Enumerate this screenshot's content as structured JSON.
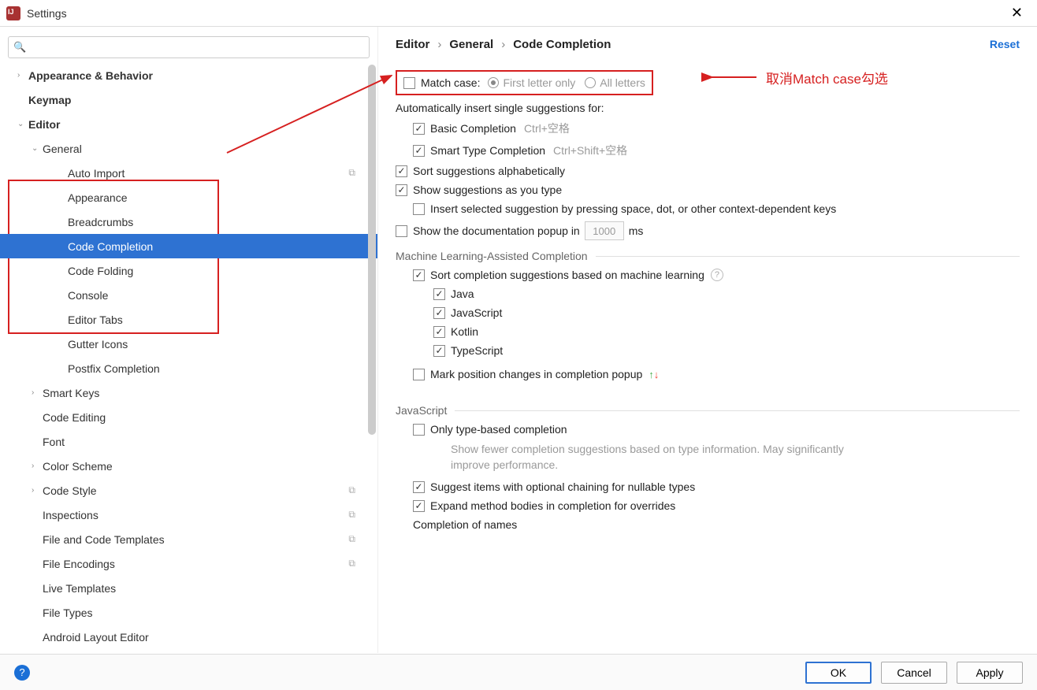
{
  "window": {
    "title": "Settings"
  },
  "search": {
    "placeholder": ""
  },
  "sidebar": {
    "items": [
      {
        "label": "Appearance & Behavior",
        "bold": true,
        "chev": "›"
      },
      {
        "label": "Keymap",
        "bold": true
      },
      {
        "label": "Editor",
        "bold": true,
        "chev": "⌄"
      },
      {
        "label": "General",
        "level": 1,
        "chev": "⌄"
      },
      {
        "label": "Auto Import",
        "level": 2,
        "copy": true
      },
      {
        "label": "Appearance",
        "level": 2
      },
      {
        "label": "Breadcrumbs",
        "level": 2
      },
      {
        "label": "Code Completion",
        "level": 2,
        "selected": true
      },
      {
        "label": "Code Folding",
        "level": 2
      },
      {
        "label": "Console",
        "level": 2
      },
      {
        "label": "Editor Tabs",
        "level": 2
      },
      {
        "label": "Gutter Icons",
        "level": 2
      },
      {
        "label": "Postfix Completion",
        "level": 2
      },
      {
        "label": "Smart Keys",
        "level": 1,
        "chev": "›"
      },
      {
        "label": "Code Editing",
        "level": 1
      },
      {
        "label": "Font",
        "level": 1
      },
      {
        "label": "Color Scheme",
        "level": 1,
        "chev": "›"
      },
      {
        "label": "Code Style",
        "level": 1,
        "chev": "›",
        "copy": true
      },
      {
        "label": "Inspections",
        "level": 1,
        "copy": true
      },
      {
        "label": "File and Code Templates",
        "level": 1,
        "copy": true
      },
      {
        "label": "File Encodings",
        "level": 1,
        "copy": true
      },
      {
        "label": "Live Templates",
        "level": 1
      },
      {
        "label": "File Types",
        "level": 1
      },
      {
        "label": "Android Layout Editor",
        "level": 1
      }
    ]
  },
  "breadcrumb": {
    "a": "Editor",
    "b": "General",
    "c": "Code Completion"
  },
  "reset": "Reset",
  "main": {
    "matchCase": {
      "label": "Match case:",
      "opt1": "First letter only",
      "opt2": "All letters"
    },
    "autoInsert": "Automatically insert single suggestions for:",
    "basic": "Basic Completion",
    "basicHint": "Ctrl+空格",
    "smart": "Smart Type Completion",
    "smartHint": "Ctrl+Shift+空格",
    "sortAlpha": "Sort suggestions alphabetically",
    "showAsType": "Show suggestions as you type",
    "insertSpace": "Insert selected suggestion by pressing space, dot, or other context-dependent keys",
    "showDoc": "Show the documentation popup in",
    "docVal": "1000",
    "ms": "ms",
    "mlTitle": "Machine Learning-Assisted Completion",
    "mlSort": "Sort completion suggestions based on machine learning",
    "langs": {
      "java": "Java",
      "js": "JavaScript",
      "kotlin": "Kotlin",
      "ts": "TypeScript"
    },
    "markPos": "Mark position changes in completion popup",
    "jsTitle": "JavaScript",
    "onlyType": "Only type-based completion",
    "onlyTypeDesc": "Show fewer completion suggestions based on type information. May significantly improve performance.",
    "suggestOptional": "Suggest items with optional chaining for nullable types",
    "expandMethod": "Expand method bodies in completion for overrides",
    "completionNames": "Completion of names"
  },
  "annotation": "取消Match case勾选",
  "buttons": {
    "ok": "OK",
    "cancel": "Cancel",
    "apply": "Apply"
  }
}
